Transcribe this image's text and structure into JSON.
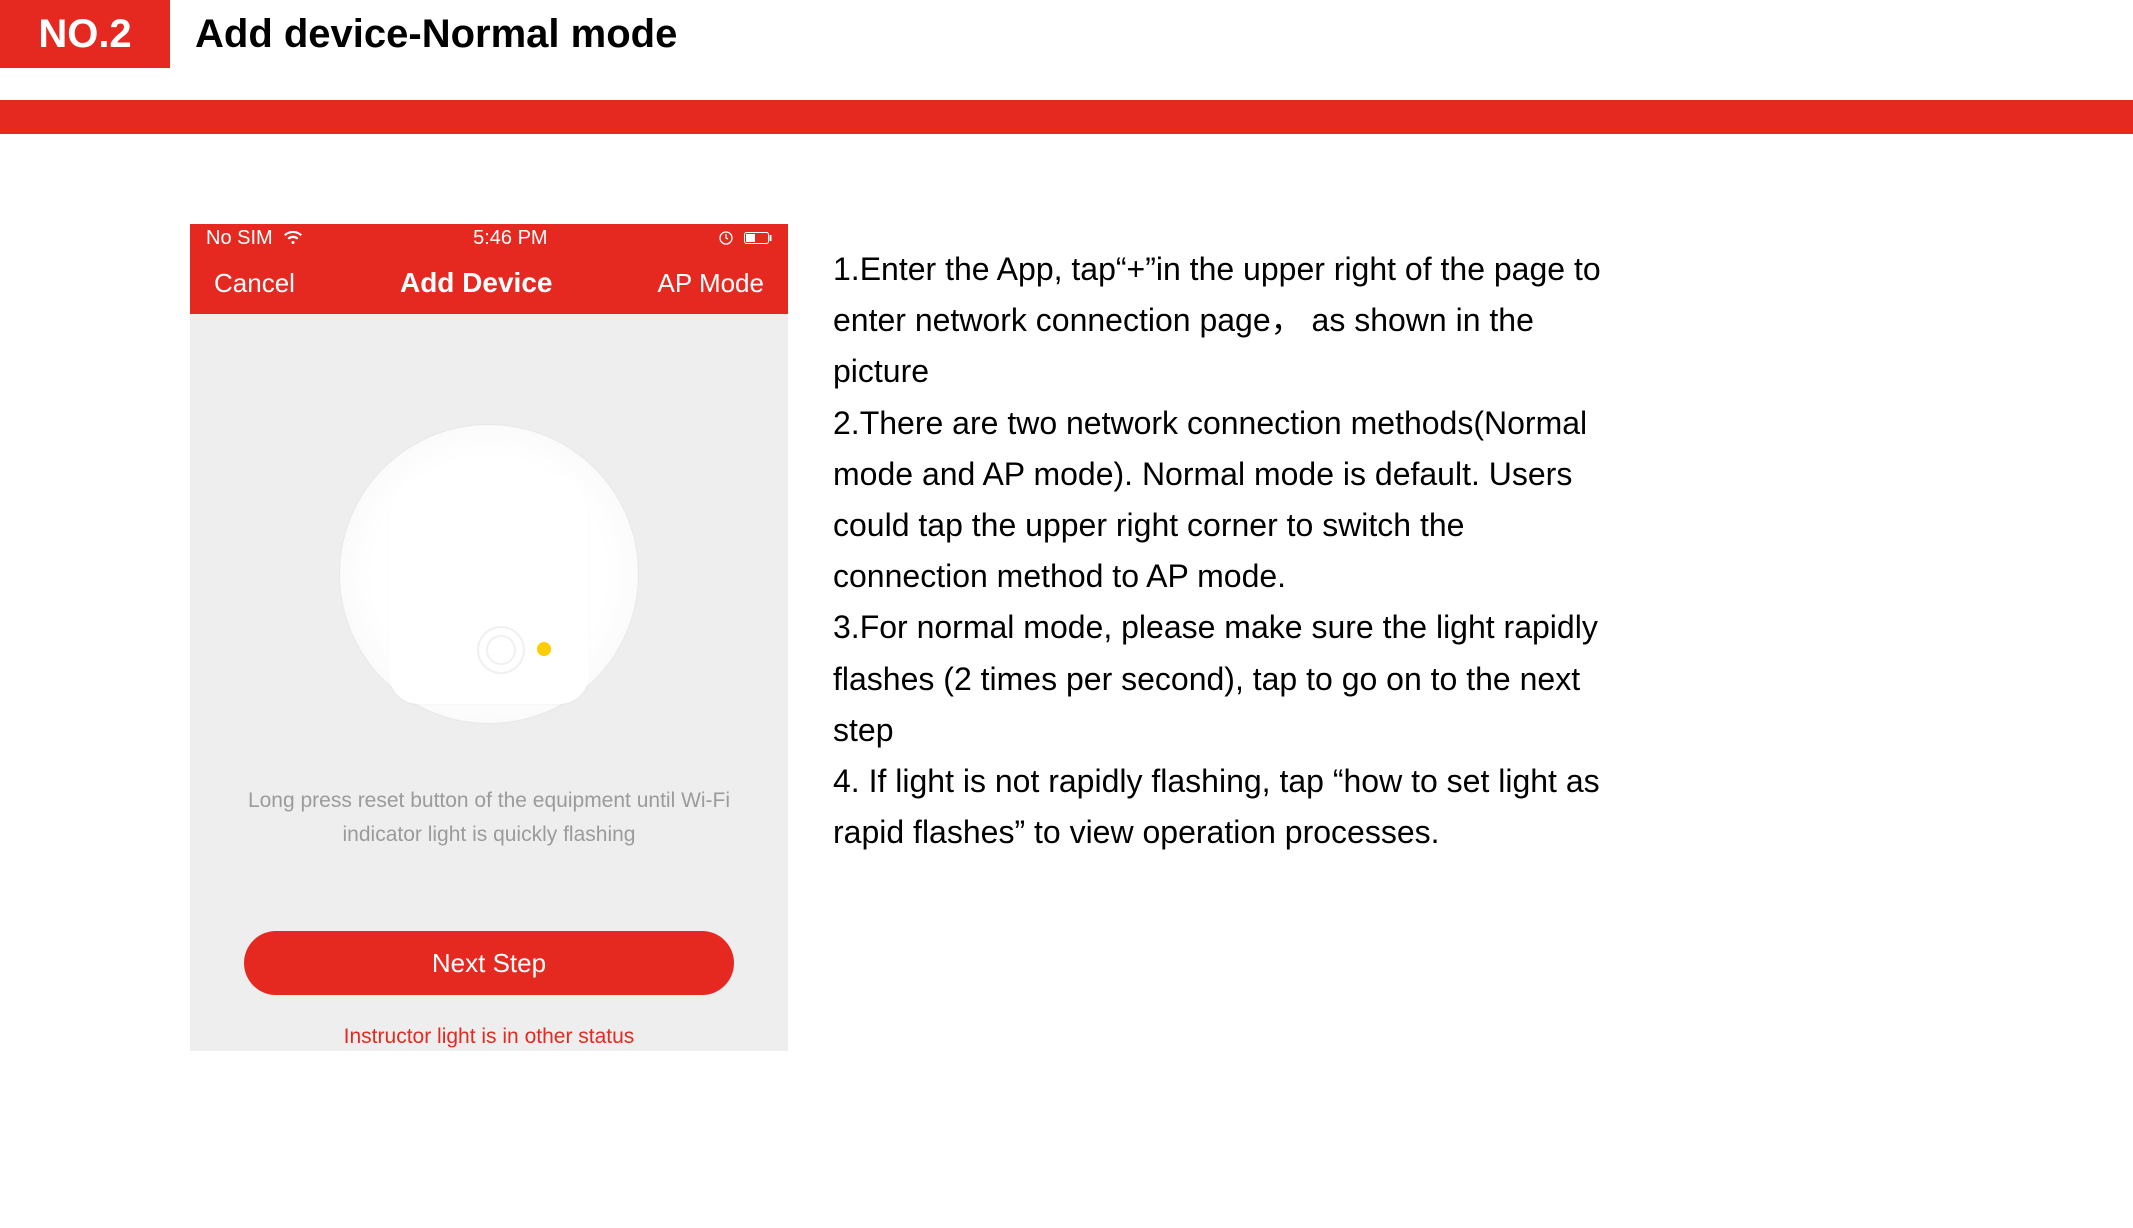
{
  "header": {
    "badge": "NO.2",
    "title": "Add device-Normal mode"
  },
  "colors": {
    "accent": "#e52920"
  },
  "phone": {
    "status": {
      "sim": "No SIM",
      "time": "5:46 PM"
    },
    "nav": {
      "left": "Cancel",
      "center": "Add Device",
      "right": "AP Mode"
    },
    "hint_line1": "Long press reset button of the equipment  until Wi-Fi",
    "hint_line2": "indicator light is quickly flashing",
    "next_label": "Next Step",
    "other_status": "Instructor light is in other status"
  },
  "instructions": {
    "p1": "1.Enter the App, tap“+”in the upper right of the page to enter network connection page， as shown in the picture",
    "p2": "2.There are two network connection methods(Normal mode and AP mode). Normal mode is default. Users could tap the upper right corner to switch the connection method to AP mode.",
    "p3": "3.For normal mode, please make sure the light rapidly flashes (2 times per second), tap to go on to the next step",
    "p4": "4. If light is not rapidly flashing, tap “how to set light as rapid flashes” to view operation processes."
  }
}
